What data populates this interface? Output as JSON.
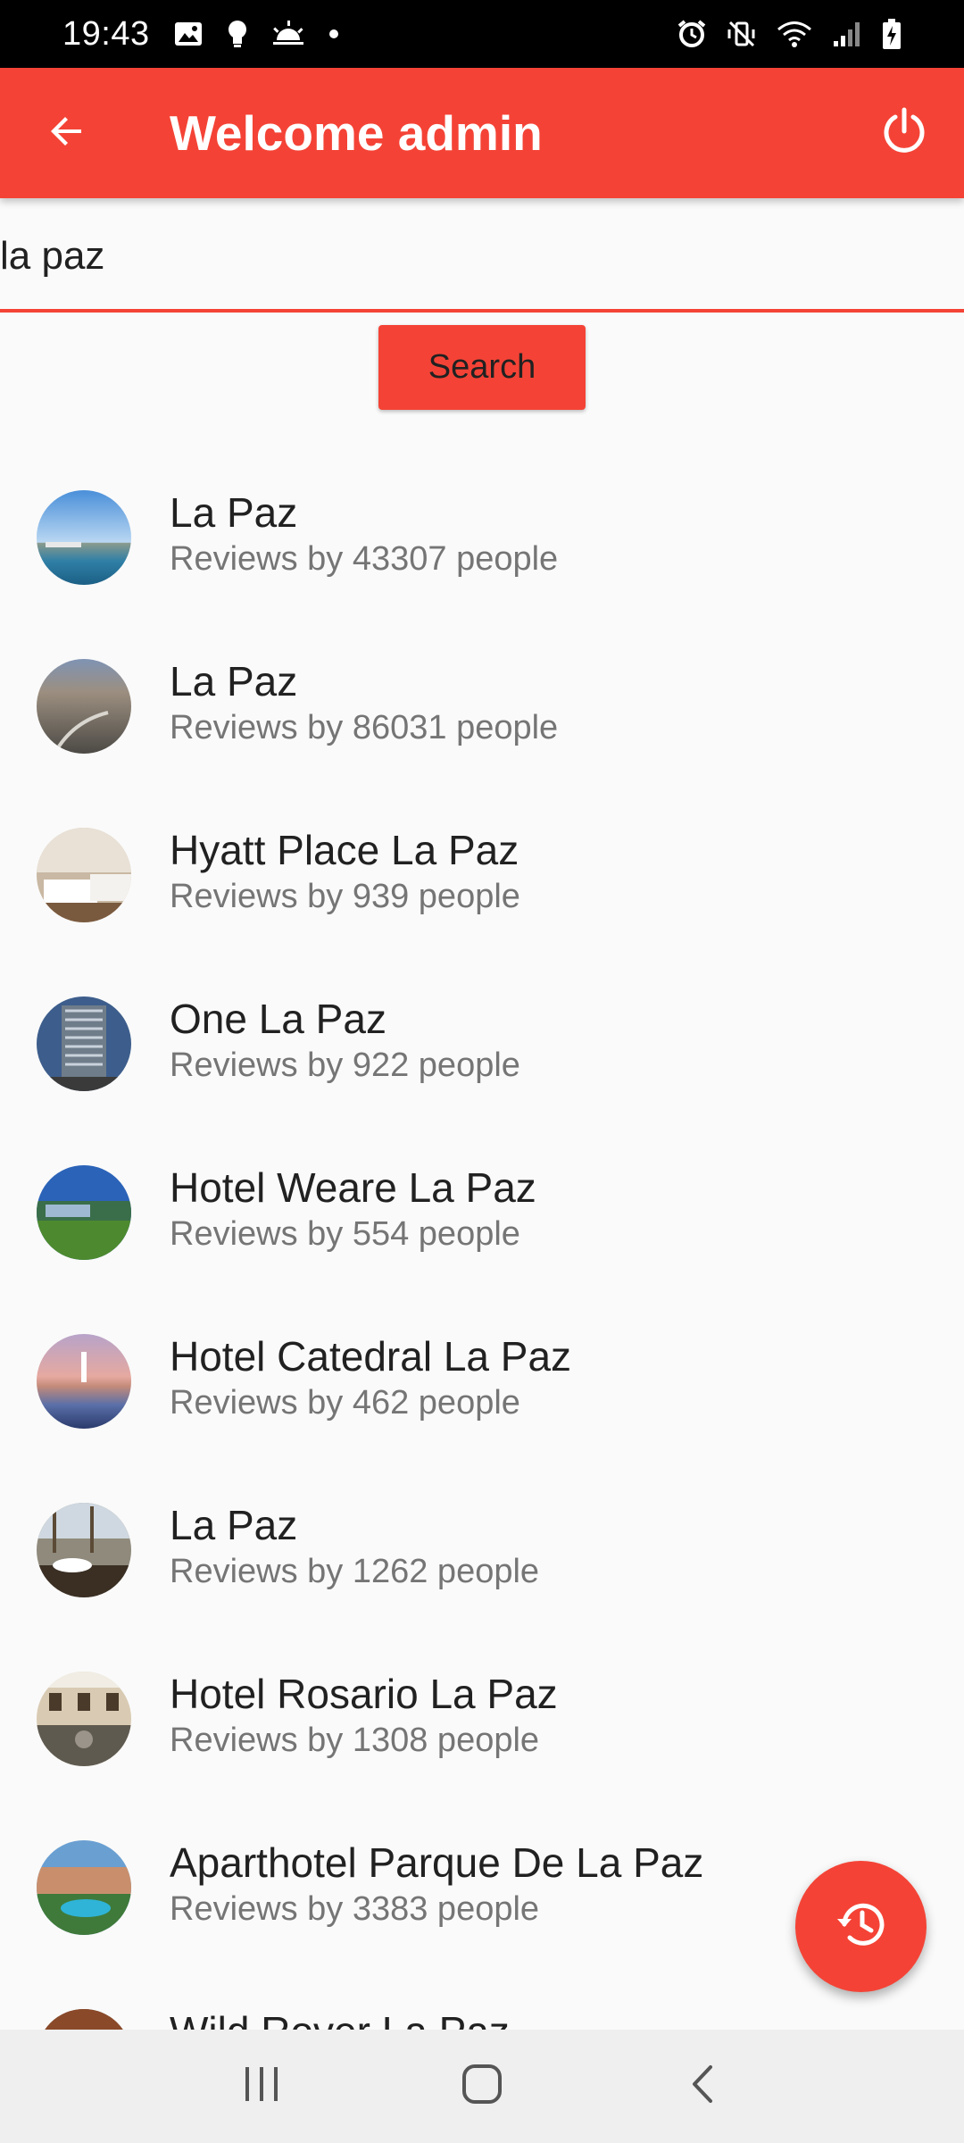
{
  "status_bar": {
    "time": "19:43",
    "left_icons": [
      "image-icon",
      "lightbulb-icon",
      "weather-sunrise-icon",
      "dot-icon"
    ],
    "right_icons": [
      "alarm-icon",
      "vibrate-off-icon",
      "wifi-icon",
      "signal-icon",
      "battery-charging-icon"
    ]
  },
  "app_bar": {
    "title": "Welcome admin",
    "back_icon": "arrow-back-icon",
    "power_icon": "power-icon",
    "color": "#f44336"
  },
  "search": {
    "value": "la paz",
    "button_label": "Search"
  },
  "results": [
    {
      "name": "La Paz",
      "reviews": "Reviews by 43307 people"
    },
    {
      "name": "La Paz",
      "reviews": "Reviews by 86031 people"
    },
    {
      "name": "Hyatt Place La Paz",
      "reviews": "Reviews by 939 people"
    },
    {
      "name": "One La Paz",
      "reviews": "Reviews by 922 people"
    },
    {
      "name": "Hotel Weare La Paz",
      "reviews": "Reviews by 554 people"
    },
    {
      "name": "Hotel Catedral La Paz",
      "reviews": "Reviews by 462 people"
    },
    {
      "name": "La Paz",
      "reviews": "Reviews by 1262 people"
    },
    {
      "name": "Hotel Rosario La Paz",
      "reviews": "Reviews by 1308 people"
    },
    {
      "name": "Aparthotel Parque De La Paz",
      "reviews": "Reviews by 3383 people"
    },
    {
      "name": "Wild Rover La Paz",
      "reviews": ""
    }
  ],
  "fab": {
    "icon": "history-icon"
  },
  "nav_bar": {
    "icons": [
      "recent-apps-icon",
      "home-icon",
      "back-icon"
    ]
  },
  "colors": {
    "accent": "#f44336",
    "background": "#fafafa",
    "title_text": "#212121",
    "subtitle_text": "#757575"
  }
}
